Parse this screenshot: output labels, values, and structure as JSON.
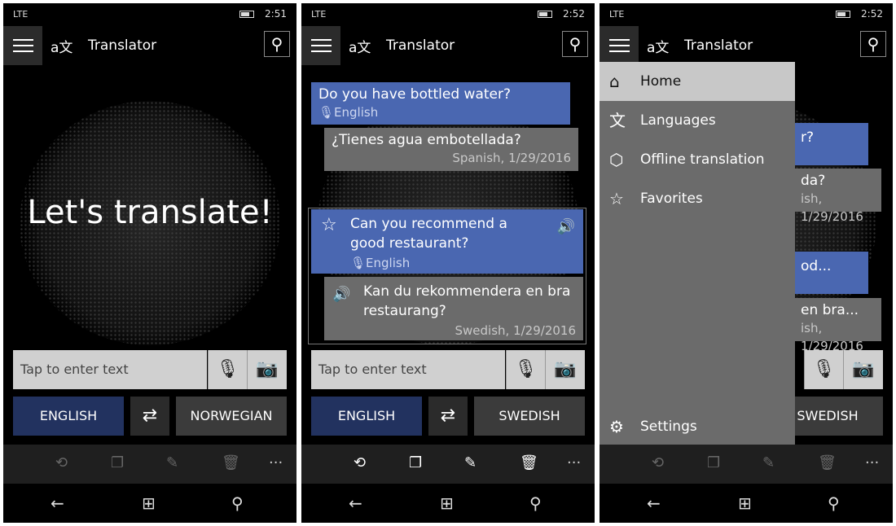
{
  "app": {
    "title": "Translator"
  },
  "screens": [
    {
      "status": {
        "network": "LTE",
        "time": "2:51"
      },
      "hero": "Let's translate!",
      "input_placeholder": "Tap to enter text",
      "source_lang": "ENGLISH",
      "target_lang": "NORWEGIAN"
    },
    {
      "status": {
        "network": "LTE",
        "time": "2:52"
      },
      "input_placeholder": "Tap to enter text",
      "source_lang": "ENGLISH",
      "target_lang": "SWEDISH",
      "conversation": [
        {
          "source": "Do you have bottled water?",
          "source_lang": "English",
          "translation": "¿Tienes agua embotellada?",
          "meta": "Spanish, 1/29/2016"
        },
        {
          "source": "Can you recommend a good restaurant?",
          "source_lang": "English",
          "translation": "Kan du rekommendera en bra restaurang?",
          "meta": "Swedish, 1/29/2016"
        }
      ]
    },
    {
      "status": {
        "network": "LTE",
        "time": "2:52"
      },
      "target_lang": "SWEDISH",
      "peek": [
        "r?",
        "da?",
        "ish, 1/29/2016",
        "od...",
        "en bra...",
        "ish, 1/29/2016"
      ],
      "menu": [
        {
          "label": "Home",
          "icon": "home-icon",
          "active": true
        },
        {
          "label": "Languages",
          "icon": "languages-icon"
        },
        {
          "label": "Offline translation",
          "icon": "offline-package-icon"
        },
        {
          "label": "Favorites",
          "icon": "star-icon"
        }
      ],
      "settings": "Settings"
    }
  ],
  "appbar_more": "···",
  "colors": {
    "bubble_source": "#4a67b1",
    "bubble_target": "#6b6b6b",
    "source_lang_button": "#22325f",
    "menu_bg": "#6b6b6b",
    "menu_active": "#c8c8c8"
  }
}
